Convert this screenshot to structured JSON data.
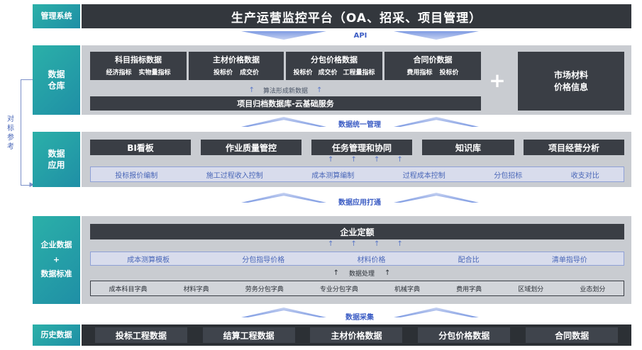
{
  "header": {
    "label": "管理系统",
    "title": "生产运营监控平台（OA、招采、项目管理）"
  },
  "ribbons": {
    "api": "API",
    "data_manage": "数据统一管理",
    "data_apply": "数据应用打通",
    "data_collect": "数据采集"
  },
  "side_note": [
    "对",
    "标",
    "参",
    "考"
  ],
  "warehouse": {
    "label_line1": "数据",
    "label_line2": "仓库",
    "modules": [
      {
        "title": "科目指标数据",
        "subs": [
          "经济指标",
          "实物量指标"
        ]
      },
      {
        "title": "主材价格数据",
        "subs": [
          "投标价",
          "成交价"
        ]
      },
      {
        "title": "分包价格数据",
        "subs": [
          "投标价",
          "成交价",
          "工程量指标"
        ]
      },
      {
        "title": "合同价数据",
        "subs": [
          "费用指标",
          "投标价"
        ]
      }
    ],
    "algorithm": "算法形成新数据",
    "archive": "项目归档数据库-云基础服务",
    "plus": "+",
    "market_line1": "市场材料",
    "market_line2": "价格信息"
  },
  "apply": {
    "label_line1": "数据",
    "label_line2": "应用",
    "modules": [
      "BI看板",
      "作业质量管控",
      "任务管理和协同",
      "知识库",
      "项目经营分析"
    ],
    "items": [
      "投标报价编制",
      "施工过程收入控制",
      "成本测算编制",
      "过程成本控制",
      "分包招标",
      "收支对比"
    ]
  },
  "enterprise": {
    "label_line1": "企业数据",
    "label_plus": "+",
    "label_line2": "数据标准",
    "quota": "企业定额",
    "row1": [
      "成本测算模板",
      "分包指导价格",
      "材料价格",
      "配合比",
      "清单指导价"
    ],
    "processing": "数据处理",
    "row2": [
      "成本科目字典",
      "材料字典",
      "劳务分包字典",
      "专业分包字典",
      "机械字典",
      "费用字典",
      "区域划分",
      "业态划分"
    ]
  },
  "history": {
    "label": "历史数据",
    "items": [
      "投标工程数据",
      "结算工程数据",
      "主材价格数据",
      "分包价格数据",
      "合同数据"
    ]
  },
  "colors": {
    "teal": "#2bb0a8",
    "dark": "#33373d",
    "panel": "#c9ccd1",
    "accent_blue": "#4a67b8"
  }
}
